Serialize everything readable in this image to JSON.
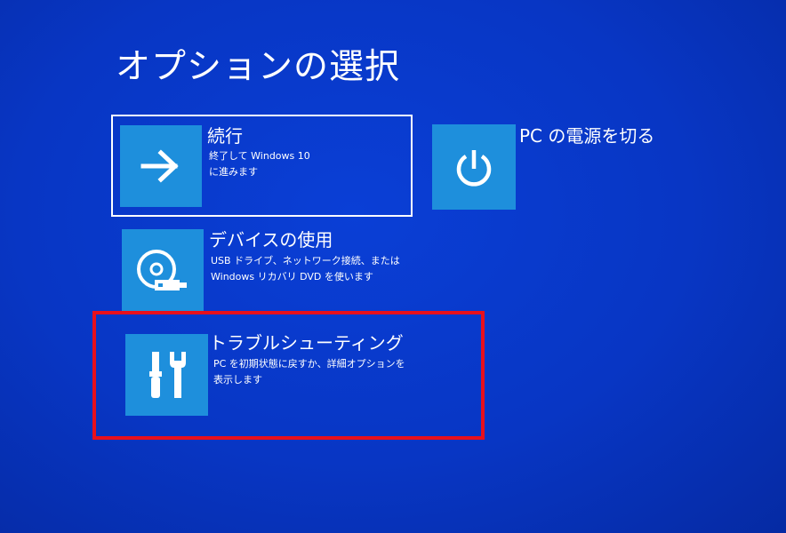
{
  "page": {
    "title": "オプションの選択"
  },
  "options": {
    "continue": {
      "icon": "arrow-right-icon",
      "label": "続行",
      "desc_line1": "終了して Windows 10",
      "desc_line2": "に進みます"
    },
    "power_off": {
      "icon": "power-icon",
      "label": "PC の電源を切る"
    },
    "device": {
      "icon": "disc-drive-icon",
      "label": "デバイスの使用",
      "desc_line1": "USB ドライブ、ネットワーク接続、または",
      "desc_line2": "Windows リカバリ DVD を使います"
    },
    "troubleshoot": {
      "icon": "tools-icon",
      "label": "トラブルシューティング",
      "desc_line1": "PC を初期状態に戻すか、詳細オプションを",
      "desc_line2": "表示します"
    }
  },
  "colors": {
    "background": "#0836c4",
    "tile": "#1e8fdc",
    "highlight": "#e8101c",
    "text": "#ffffff"
  }
}
